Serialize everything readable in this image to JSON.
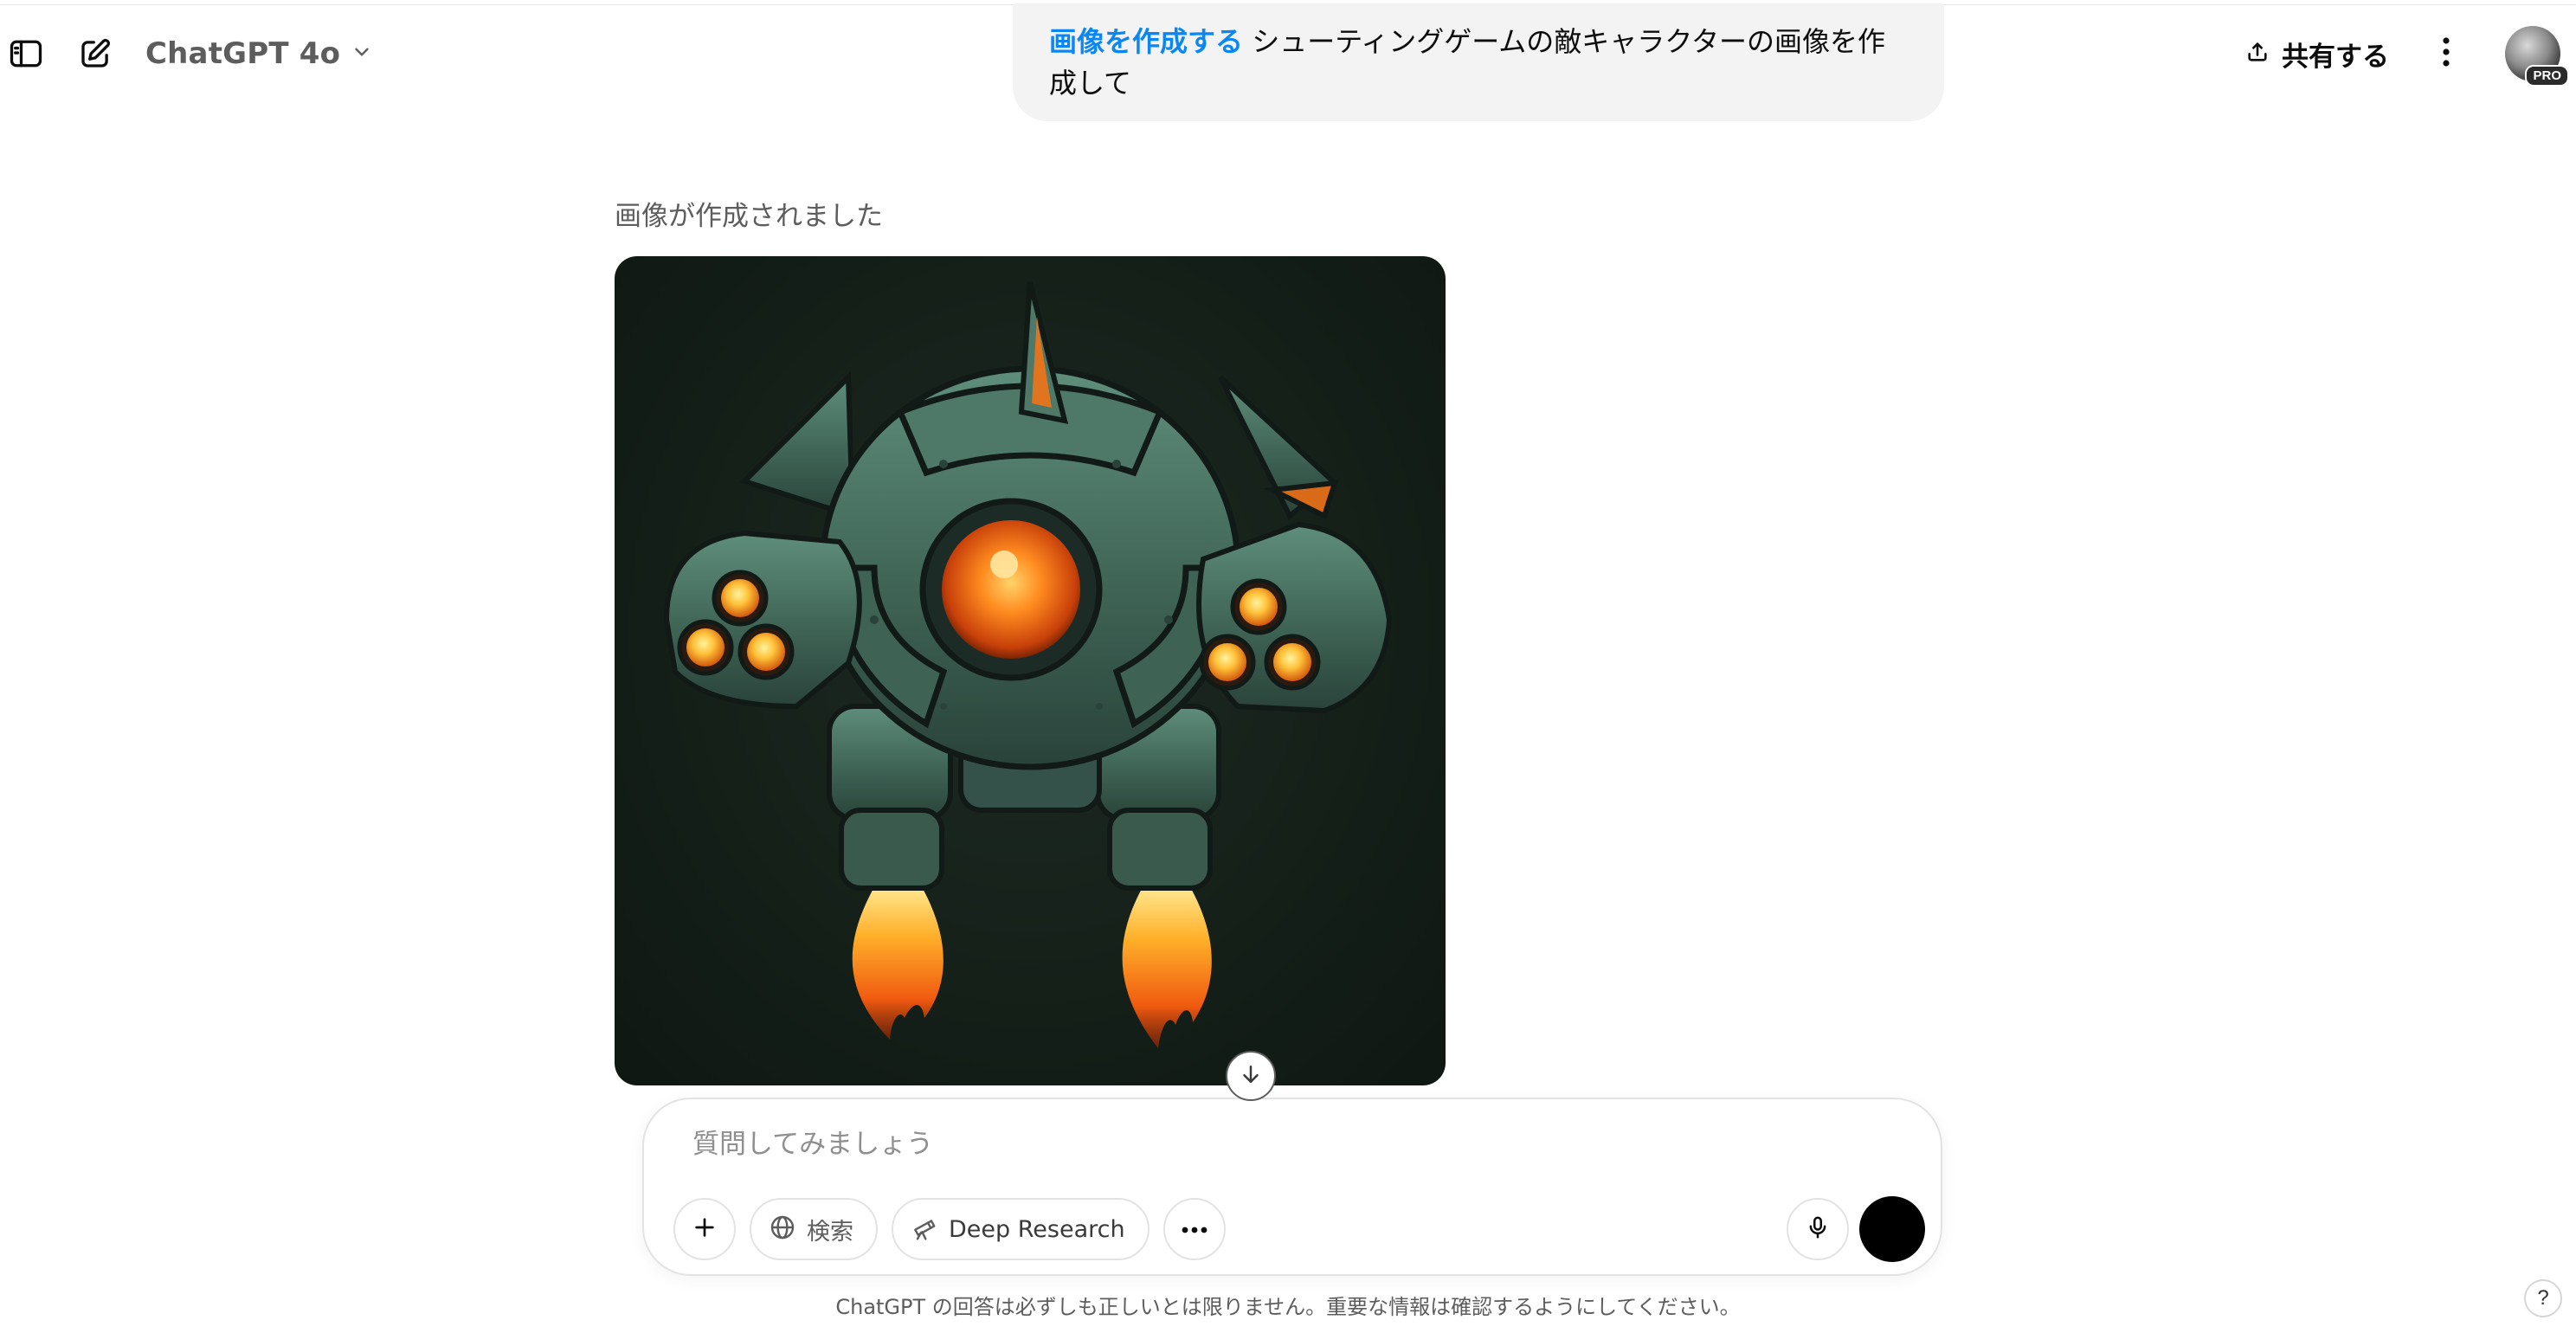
{
  "header": {
    "model_name": "ChatGPT 4o",
    "share_label": "共有する",
    "avatar_badge": "PRO"
  },
  "conversation": {
    "user_message": {
      "tool_tag": "画像を作成する",
      "text": " シューティングゲームの敵キャラクターの画像を作成して"
    },
    "assistant": {
      "status": "画像が作成されました",
      "image_alt": "ロボット型の敵キャラクター"
    }
  },
  "composer": {
    "placeholder": "質問してみましょう",
    "search_label": "検索",
    "deep_research_label": "Deep Research"
  },
  "footer": {
    "disclaimer": "ChatGPT の回答は必ずしも正しいとは限りません。重要な情報は確認するようにしてください。",
    "help_label": "?"
  },
  "colors": {
    "accent_blue": "#0b87f5",
    "bubble_bg": "#f3f3f3",
    "muted_text": "#5d5d5d"
  },
  "icons": [
    "sidebar-toggle-icon",
    "new-chat-icon",
    "chevron-down-icon",
    "share-upload-icon",
    "more-vertical-icon",
    "plus-icon",
    "globe-icon",
    "telescope-icon",
    "ellipsis-icon",
    "microphone-icon",
    "arrow-down-icon"
  ]
}
